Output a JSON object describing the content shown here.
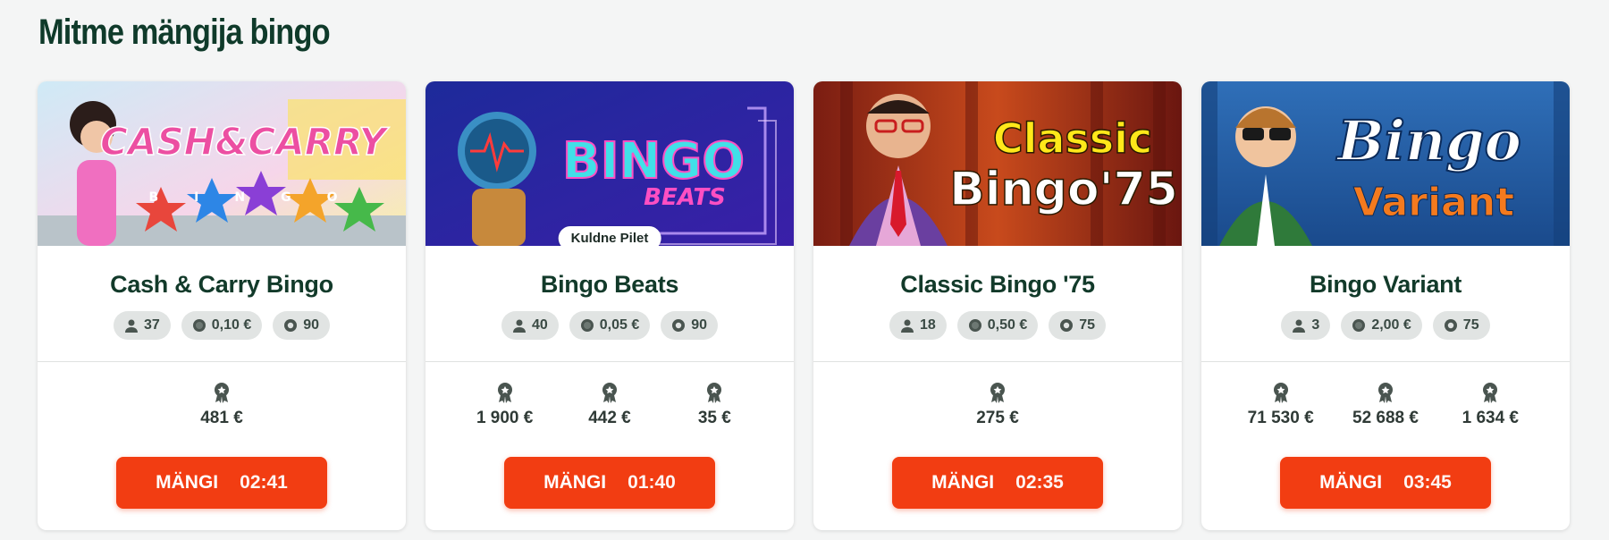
{
  "section": {
    "title": "Mitme mängija bingo"
  },
  "cards": [
    {
      "name": "Cash & Carry Bingo",
      "banner_text_top": "CASH&CARRY",
      "banner_text_bottom": "BINGO",
      "ribbon": "",
      "players": "37",
      "ticket_price": "0,10 €",
      "balls": "90",
      "prizes": [
        "481 €"
      ],
      "play_label": "MÄNGI",
      "timer": "02:41"
    },
    {
      "name": "Bingo Beats",
      "banner_text_top": "BINGO",
      "banner_text_bottom": "BEATS",
      "ribbon": "Kuldne Pilet",
      "players": "40",
      "ticket_price": "0,05 €",
      "balls": "90",
      "prizes": [
        "1 900 €",
        "442 €",
        "35 €"
      ],
      "play_label": "MÄNGI",
      "timer": "01:40"
    },
    {
      "name": "Classic Bingo '75",
      "banner_text_top": "Classic",
      "banner_text_bottom": "Bingo'75",
      "ribbon": "",
      "players": "18",
      "ticket_price": "0,50 €",
      "balls": "75",
      "prizes": [
        "275 €"
      ],
      "play_label": "MÄNGI",
      "timer": "02:35"
    },
    {
      "name": "Bingo Variant",
      "banner_text_top": "Bingo",
      "banner_text_bottom": "Variant",
      "ribbon": "",
      "players": "3",
      "ticket_price": "2,00 €",
      "balls": "75",
      "prizes": [
        "71 530 €",
        "52 688 €",
        "1 634 €"
      ],
      "play_label": "MÄNGI",
      "timer": "03:45"
    }
  ],
  "icons": {
    "players": "user-icon",
    "price": "coin-icon",
    "balls": "bingo-ball-icon",
    "prize": "award-icon"
  },
  "colors": {
    "title": "#0f3a2a",
    "play_button": "#f23d12",
    "pill_bg": "#e1e4e3"
  }
}
